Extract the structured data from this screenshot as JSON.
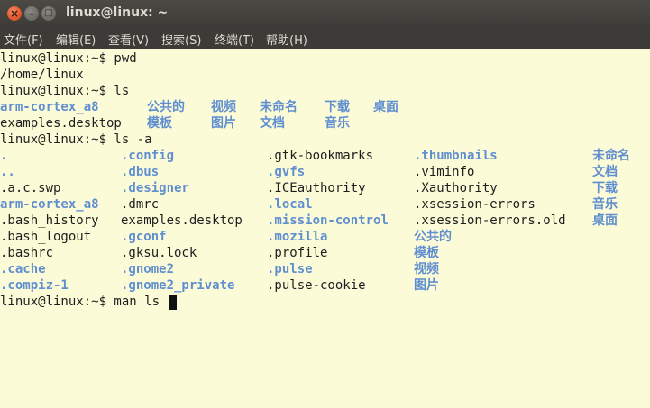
{
  "window": {
    "title": "linux@linux: ~",
    "buttons": {
      "close": "×",
      "minimize": "–",
      "maximize": "□"
    }
  },
  "menubar": [
    "文件(F)",
    "编辑(E)",
    "查看(V)",
    "搜索(S)",
    "终端(T)",
    "帮助(H)"
  ],
  "terminal": {
    "prompt": "linux@linux:~$",
    "line1": "linux@linux:~$ pwd",
    "line2": "/home/linux",
    "line3": "linux@linux:~$ ls",
    "ls_row1": [
      "arm-cortex_a8",
      "公共的",
      "视频",
      "未命名",
      "下载",
      "桌面"
    ],
    "ls_row2": [
      "examples.desktop",
      "模板",
      "图片",
      "文档",
      "音乐"
    ],
    "line_lsa": "linux@linux:~$ ls -a",
    "col1": [
      ".",
      "..",
      ".a.c.swp",
      "arm-cortex_a8",
      ".bash_history",
      ".bash_logout",
      ".bashrc",
      ".cache",
      ".compiz-1"
    ],
    "col2": [
      ".config",
      ".dbus",
      ".designer",
      ".dmrc",
      "examples.desktop",
      ".gconf",
      ".gksu.lock",
      ".gnome2",
      ".gnome2_private"
    ],
    "col3": [
      ".gtk-bookmarks",
      ".gvfs",
      ".ICEauthority",
      ".local",
      ".mission-control",
      ".mozilla",
      ".profile",
      ".pulse",
      ".pulse-cookie"
    ],
    "col4": [
      ".thumbnails",
      ".viminfo",
      ".Xauthority",
      ".xsession-errors",
      ".xsession-errors.old",
      "公共的",
      "模板",
      "视频",
      "图片"
    ],
    "col5": [
      "未命名",
      "文档",
      "下载",
      "音乐",
      "桌面"
    ],
    "last_line": "linux@linux:~$ man ls"
  },
  "colors": {
    "directory": "#5f8fd0",
    "text": "#1e1e1e",
    "background": "#fcfbd8"
  }
}
